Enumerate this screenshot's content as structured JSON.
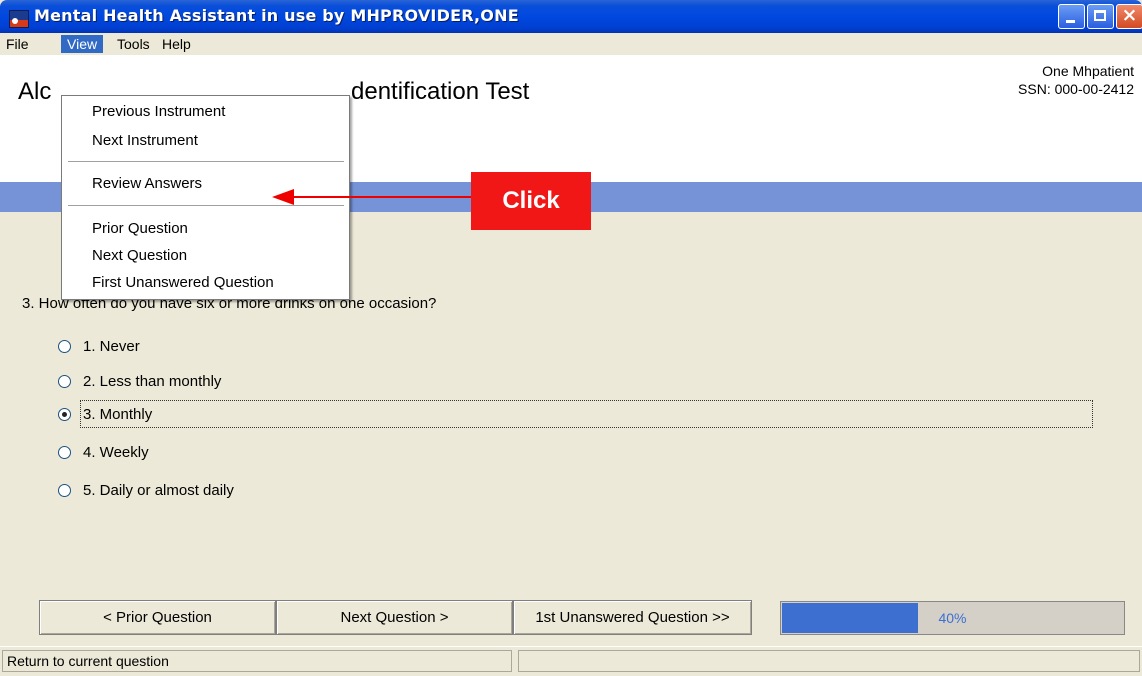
{
  "window": {
    "title": "Mental Health Assistant in use by MHPROVIDER,ONE",
    "close_glyph": "×"
  },
  "menu": {
    "items": [
      "File",
      "View",
      "Tools",
      "Help"
    ],
    "active": "View"
  },
  "dropdown": {
    "items": [
      "Previous Instrument",
      "Next Instrument",
      "Review Answers",
      "Prior Question",
      "Next Question",
      "First Unanswered Question"
    ]
  },
  "header": {
    "title_left": "Alc",
    "title_right": "dentification Test",
    "patient_name": "One Mhpatient",
    "patient_ssn": "SSN: 000-00-2412"
  },
  "question": {
    "text": "3. How often do you have six or more drinks on one occasion?",
    "options": [
      "1. Never",
      "2. Less than monthly",
      "3. Monthly",
      "4. Weekly",
      "5. Daily or almost daily"
    ],
    "selected_index": 2
  },
  "nav": {
    "prior": "< Prior Question",
    "next": "Next Question >",
    "first_unanswered": "1st Unanswered Question >>"
  },
  "progress": {
    "percent": 40,
    "label": "40%"
  },
  "status": {
    "text": "Return to current question"
  },
  "annotation": {
    "label": "Click",
    "color": "#f21717"
  }
}
